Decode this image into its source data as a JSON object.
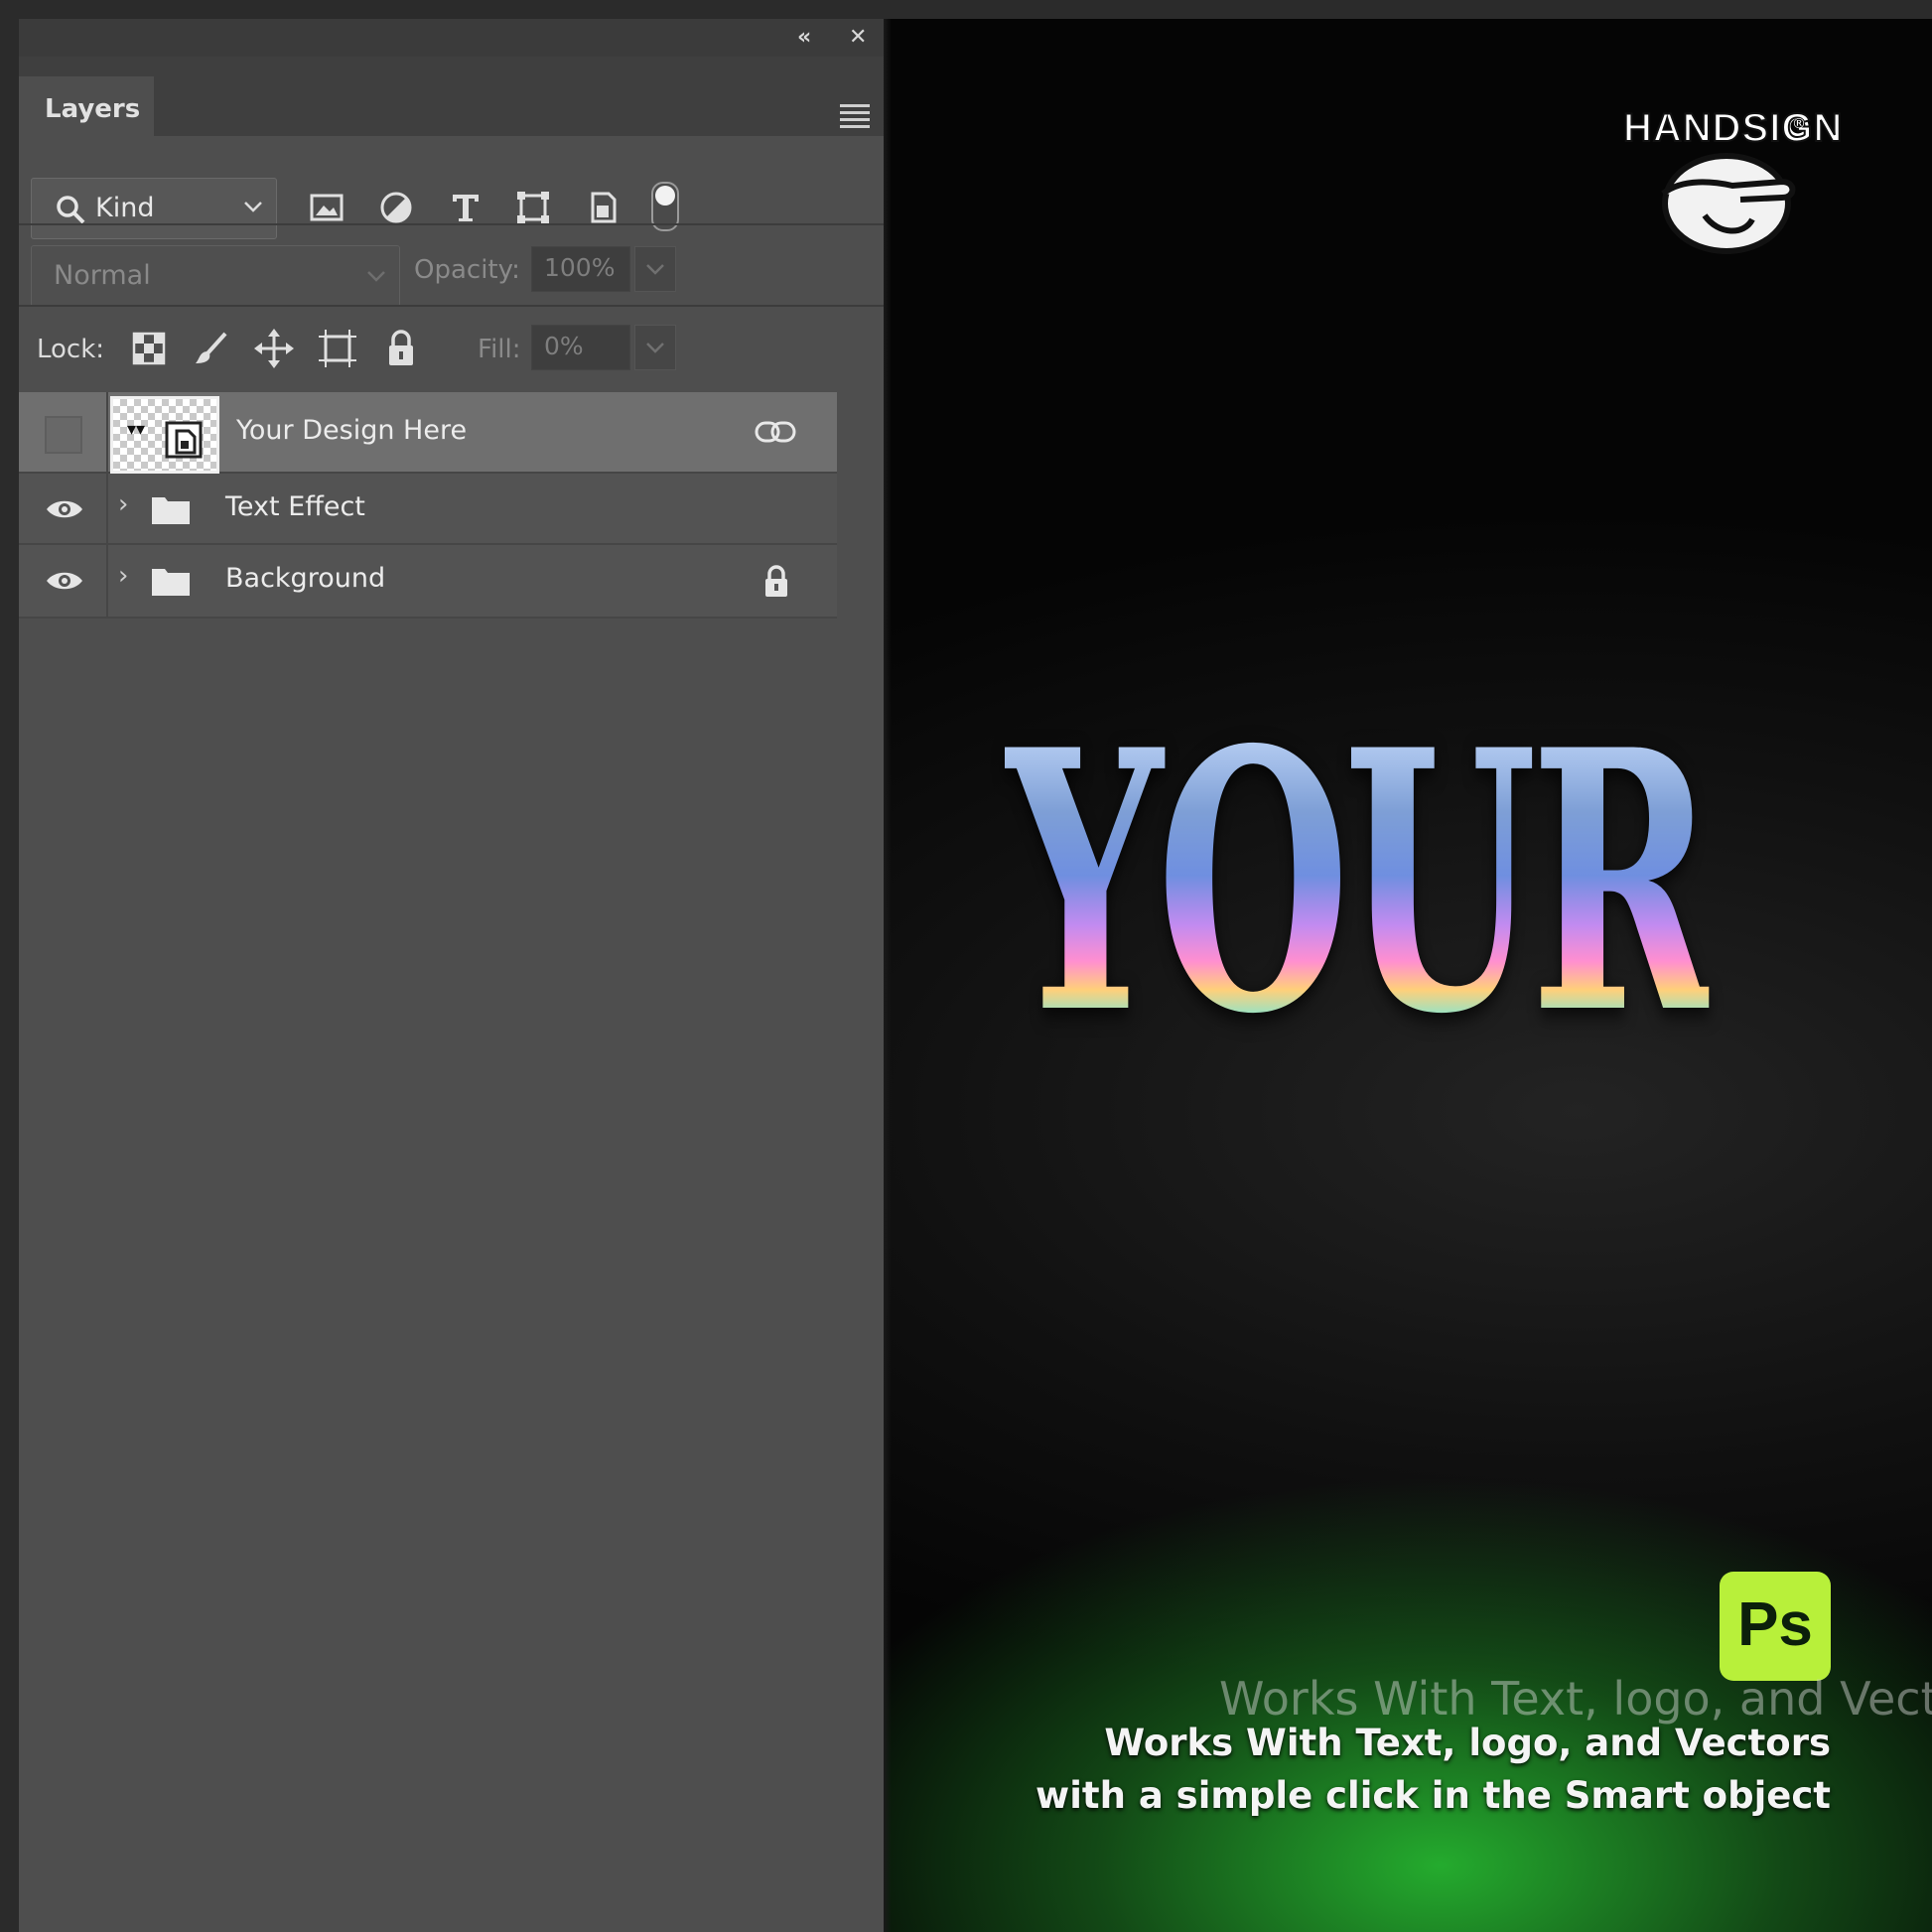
{
  "panel": {
    "tab_label": "Layers",
    "topbar": {
      "collapse_icon": "double-chevron-left-icon",
      "close_icon": "close-icon"
    },
    "menu_icon": "hamburger-menu-icon"
  },
  "filter": {
    "kind_label": "Kind",
    "icons": [
      "image-filter-icon",
      "adjustment-filter-icon",
      "type-filter-icon",
      "shape-filter-icon",
      "smart-object-filter-icon"
    ]
  },
  "blend": {
    "mode": "Normal",
    "opacity_label": "Opacity:",
    "opacity_value": "100%"
  },
  "lock": {
    "label": "Lock:",
    "icons": [
      "lock-transparent-icon",
      "lock-paint-icon",
      "lock-position-icon",
      "lock-artboard-icon",
      "lock-all-icon"
    ],
    "fill_label": "Fill:",
    "fill_value": "0%"
  },
  "layers": [
    {
      "name": "Your Design Here",
      "type": "smart-object",
      "visible": false,
      "selected": true,
      "linked": true
    },
    {
      "name": "Text Effect",
      "type": "group",
      "visible": true,
      "locked": false
    },
    {
      "name": "Background",
      "type": "group",
      "visible": true,
      "locked": true
    }
  ],
  "canvas": {
    "logo_text": "HANDSIGN",
    "logo_mark": "®",
    "headline": "YOUR",
    "badge_text": "Ps",
    "ghost_caption": "Works With Text, logo, and Vectors",
    "caption_line1": "Works With Text, logo, and Vectors",
    "caption_line2": "with a simple click in the Smart object",
    "accent_green": "#b8f03a"
  }
}
